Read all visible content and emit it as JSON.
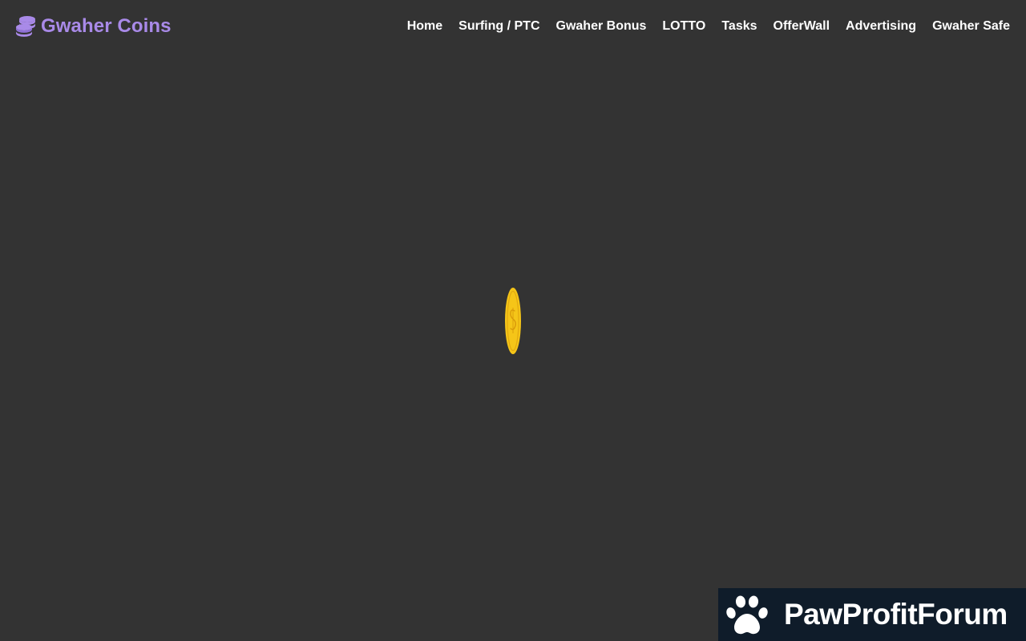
{
  "header": {
    "brand_name": "Gwaher Coins",
    "brand_icon": "coins-stack-icon",
    "brand_color": "#a98ae8"
  },
  "nav": {
    "items": [
      {
        "label": "Home"
      },
      {
        "label": "Surfing / PTC"
      },
      {
        "label": "Gwaher Bonus"
      },
      {
        "label": "LOTTO"
      },
      {
        "label": "Tasks"
      },
      {
        "label": "OfferWall"
      },
      {
        "label": "Advertising"
      },
      {
        "label": "Gwaher Safe"
      }
    ]
  },
  "loader": {
    "icon": "spinning-coin-icon",
    "symbol": "$",
    "color": "#f5c518"
  },
  "watermark": {
    "text": "PawProfitForum",
    "icon": "paw-icon",
    "background": "#0f1c2a"
  },
  "colors": {
    "page_background": "#333333",
    "nav_text": "#ffffff"
  }
}
